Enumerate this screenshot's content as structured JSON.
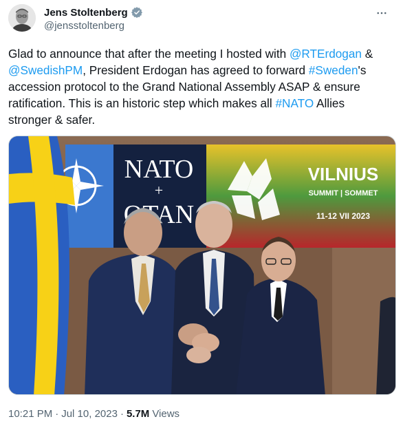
{
  "author": {
    "display_name": "Jens Stoltenberg",
    "handle": "@jensstoltenberg",
    "verified_icon": "verified-badge-icon",
    "more_icon": "more-options-icon"
  },
  "tweet": {
    "segments": [
      {
        "text": "Glad to announce that after the meeting I hosted with ",
        "type": "text"
      },
      {
        "text": "@RTErdogan",
        "type": "link"
      },
      {
        "text": " & ",
        "type": "text"
      },
      {
        "text": "@SwedishPM",
        "type": "link"
      },
      {
        "text": ", President Erdogan has agreed to forward ",
        "type": "text"
      },
      {
        "text": "#Sweden",
        "type": "link"
      },
      {
        "text": "'s accession protocol to the Grand National Assembly ASAP & ensure ratification. This is an historic step which makes all ",
        "type": "text"
      },
      {
        "text": "#NATO",
        "type": "link"
      },
      {
        "text": " Allies stronger & safer.",
        "type": "text"
      }
    ]
  },
  "photo": {
    "backdrop_nato": "NATO",
    "backdrop_plus": "+",
    "backdrop_otan": "OTAN",
    "backdrop_city": "VILNIUS",
    "backdrop_summit": "SUMMIT | SOMMET",
    "backdrop_dates": "11-12 VII 2023",
    "colors": {
      "nato_blue": "#1f4fa6",
      "nato_navy": "#0e1f46",
      "lt_yellow": "#f2c21b",
      "lt_green": "#1e8a4a",
      "lt_red": "#b8262b",
      "se_blue": "#2a5fc1",
      "se_yellow": "#f7d117"
    }
  },
  "meta": {
    "time": "10:21 PM",
    "separator1": "·",
    "date": "Jul 10, 2023",
    "separator2": "·",
    "views_count": "5.7M",
    "views_label": "Views"
  }
}
